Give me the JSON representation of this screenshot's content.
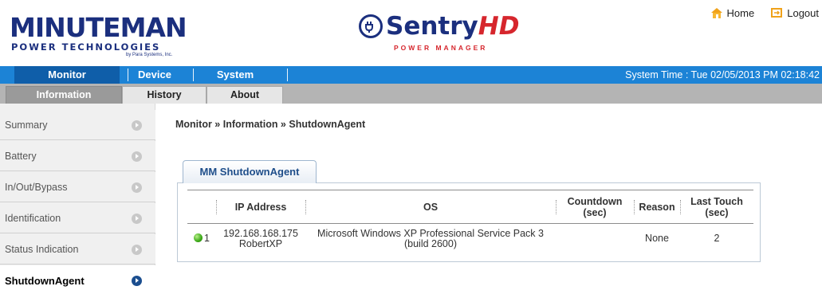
{
  "header": {
    "brand_main": "MINUTEMAN",
    "brand_sub": "POWER TECHNOLOGIES",
    "brand_tiny": "by Para Systems, Inc.",
    "product_name_a": "Sentry",
    "product_name_b": "HD",
    "product_sub": "POWER MANAGER",
    "links": [
      {
        "label": "Home",
        "icon": "home-icon"
      },
      {
        "label": "Logout",
        "icon": "logout-icon"
      }
    ]
  },
  "mainnav": {
    "items": [
      {
        "label": "Monitor",
        "active": true
      },
      {
        "label": "Device",
        "active": false
      },
      {
        "label": "System",
        "active": false
      }
    ],
    "system_time": "System Time : Tue 02/05/2013 PM 02:18:42"
  },
  "subnav": {
    "tabs": [
      {
        "label": "Information",
        "active": true
      },
      {
        "label": "History",
        "active": false
      },
      {
        "label": "About",
        "active": false
      }
    ]
  },
  "sidebar": {
    "items": [
      {
        "label": "Summary",
        "active": false
      },
      {
        "label": "Battery",
        "active": false
      },
      {
        "label": "In/Out/Bypass",
        "active": false
      },
      {
        "label": "Identification",
        "active": false
      },
      {
        "label": "Status Indication",
        "active": false
      },
      {
        "label": "ShutdownAgent",
        "active": true
      }
    ]
  },
  "content": {
    "breadcrumb": "Monitor » Information » ShutdownAgent",
    "panel_tab": "MM ShutdownAgent",
    "table": {
      "headers": [
        "",
        "IP Address",
        "OS",
        "Countdown (sec)",
        "Reason",
        "Last Touch (sec)"
      ],
      "rows": [
        {
          "status": "green",
          "index": "1",
          "ip": "192.168.168.175",
          "host": "RobertXP",
          "os": "Microsoft Windows XP Professional Service Pack 3 (build 2600)",
          "countdown": "",
          "reason": "None",
          "last_touch": "2"
        }
      ]
    }
  },
  "colors": {
    "nav_blue": "#1c83d6",
    "nav_active": "#0f5ea9",
    "subnav_gray": "#b4b4b4",
    "brand_navy": "#1b2f7e",
    "brand_red": "#d6262d"
  }
}
